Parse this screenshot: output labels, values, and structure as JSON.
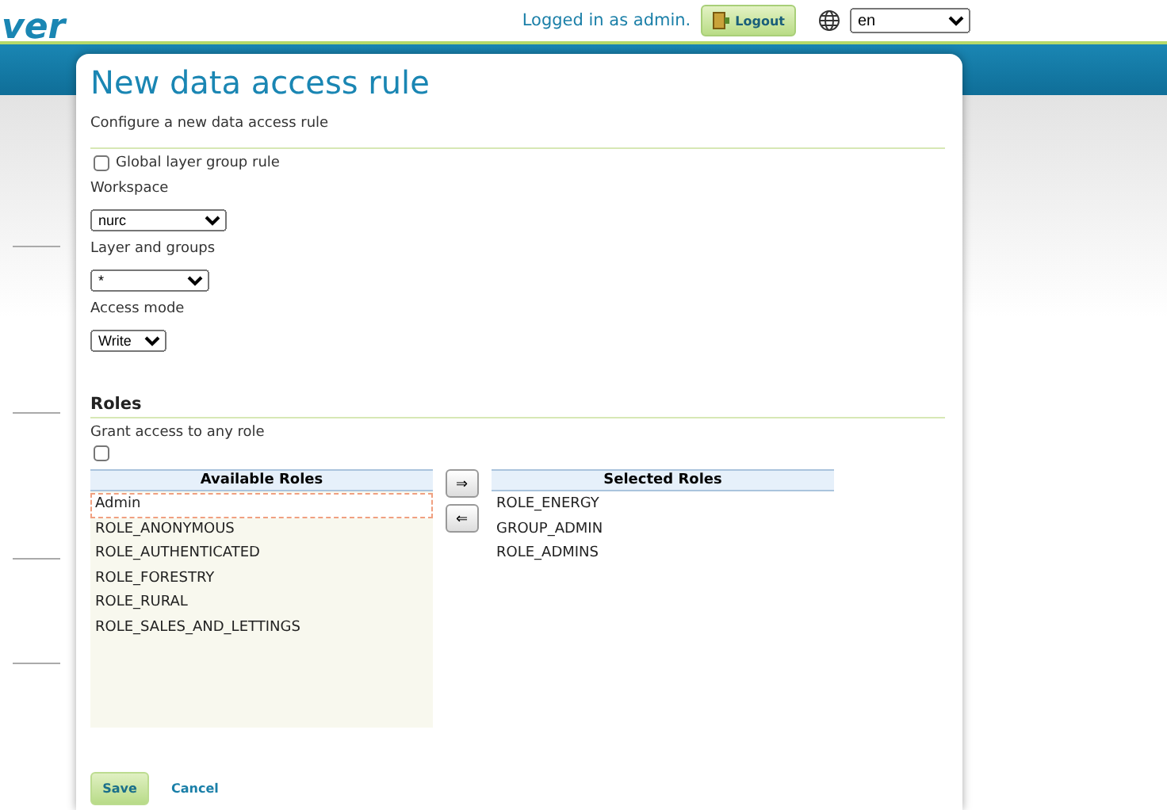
{
  "header": {
    "logo": "ver",
    "login_text": "Logged in as admin.",
    "logout_button": "Logout",
    "language": "en"
  },
  "page": {
    "title": "New data access rule",
    "description": "Configure a new data access rule"
  },
  "form": {
    "global_layer_group": {
      "label": "Global layer group rule",
      "checked": false
    },
    "workspace": {
      "label": "Workspace",
      "value": "nurc"
    },
    "layer": {
      "label": "Layer and groups",
      "value": "*"
    },
    "access_mode": {
      "label": "Access mode",
      "value": "Write"
    }
  },
  "roles": {
    "heading": "Roles",
    "grant_any": {
      "label": "Grant access to any role",
      "checked": false
    },
    "available": {
      "heading": "Available Roles",
      "items": [
        {
          "label": "Admin",
          "selected": true
        },
        {
          "label": "ROLE_ANONYMOUS",
          "selected": false
        },
        {
          "label": "ROLE_AUTHENTICATED",
          "selected": false
        },
        {
          "label": "ROLE_FORESTRY",
          "selected": false
        },
        {
          "label": "ROLE_RURAL",
          "selected": false
        },
        {
          "label": "ROLE_SALES_AND_LETTINGS",
          "selected": false
        }
      ]
    },
    "add_button": "⇒",
    "remove_button": "⇐",
    "selected": {
      "heading": "Selected Roles",
      "items": [
        "ROLE_ENERGY",
        "GROUP_ADMIN",
        "ROLE_ADMINS"
      ]
    }
  },
  "buttons": {
    "save": "Save",
    "cancel": "Cancel"
  }
}
